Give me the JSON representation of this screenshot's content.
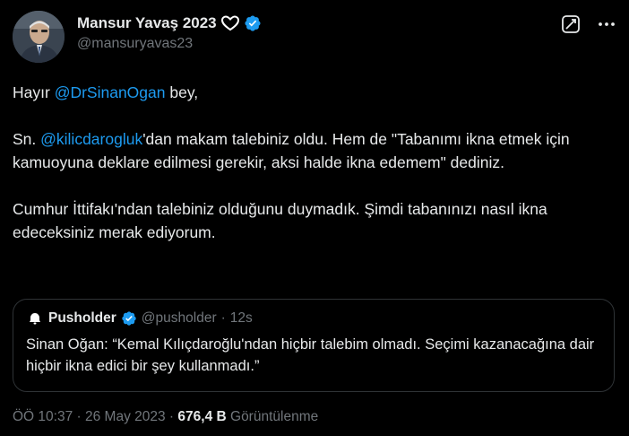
{
  "author": {
    "display_name": "Mansur Yavaş 2023",
    "emoji": "🫶",
    "handle": "@mansuryavas23",
    "verified": true,
    "verified_color": "#1d9bf0",
    "avatar_icon": "profile-photo"
  },
  "header_actions": {
    "grok_icon": "grok-icon",
    "more_icon": "more-icon"
  },
  "body": {
    "p1_prefix": "Hayır ",
    "p1_mention": "@DrSinanOgan",
    "p1_suffix": " bey,",
    "p2_prefix": "Sn. ",
    "p2_mention": "@kilicdarogluk",
    "p2_suffix": "'dan makam talebiniz oldu. Hem de \"Tabanımı ikna etmek için kamuoyuna deklare edilmesi gerekir, aksi halde ikna edemem\" dediniz.",
    "p3": "Cumhur İttifakı'ndan talebiniz olduğunu duymadık. Şimdi tabanınızı nasıl ikna edeceksiniz merak ediyorum."
  },
  "quote": {
    "name": "Pusholder",
    "verified": true,
    "handle": "@pusholder",
    "separator": "·",
    "time": "12s",
    "text": "Sinan Oğan: “Kemal Kılıçdaroğlu'ndan hiçbir talebim olmadı. Seçimi kazanacağına dair hiçbir ikna edici bir şey kullanmadı.”"
  },
  "meta": {
    "time": "ÖÖ 10:37",
    "sep1": " · ",
    "date": "26 May 2023",
    "sep2": " · ",
    "views_count": "676,4 B",
    "views_label": " Görüntülenme"
  },
  "colors": {
    "background": "#000000",
    "text": "#e7e9ea",
    "secondary": "#71767b",
    "link": "#1d9bf0",
    "border": "#2f3336"
  }
}
